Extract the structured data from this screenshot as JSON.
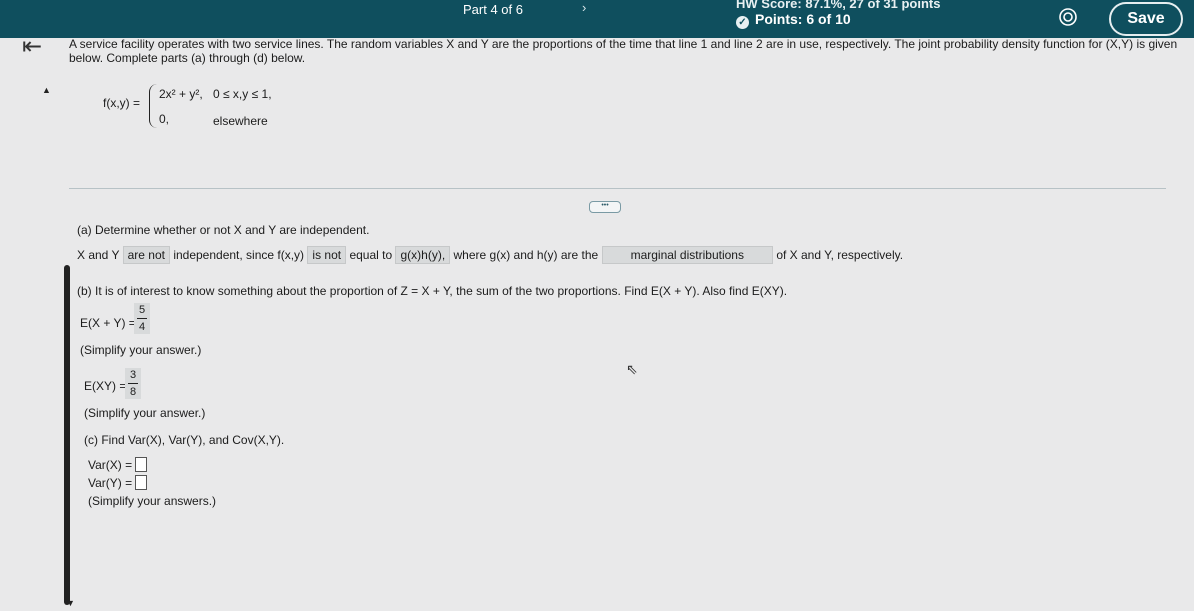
{
  "header": {
    "part": "Part 4 of 6",
    "next_chevron": "›",
    "hw_score": "HW Score: 87.1%, 27 of 31 points",
    "points": "Points: 6 of 10",
    "save_label": "Save"
  },
  "nav": {
    "back_icon": "⇤"
  },
  "problem": {
    "statement": "A service facility operates with two service lines. The random variables X and Y are the proportions of the time that line 1 and line 2 are in use, respectively. The joint probability density function for (X,Y) is given below. Complete parts (a) through (d) below.",
    "pdf_lhs": "f(x,y) =",
    "case1_expr": "2x² + y²,",
    "case1_domain": "0 ≤ x,y ≤ 1,",
    "case2_expr": "0,",
    "case2_domain": "elsewhere"
  },
  "more_button": "•••",
  "part_a": {
    "question": "(a) Determine whether or not X and Y are independent.",
    "pre": "X and Y",
    "answer1": "are not",
    "mid1": "independent, since f(x,y)",
    "answer2": "is not",
    "mid2": "equal to",
    "answer3": "g(x)h(y),",
    "mid3": "where g(x) and h(y) are the",
    "answer4": "marginal distributions",
    "post": "of X and Y, respectively."
  },
  "part_b": {
    "question": "(b) It is of interest to know something about the proportion of Z = X + Y, the sum of the two proportions. Find E(X + Y). Also find E(XY).",
    "exy_sum_label": "E(X + Y) =",
    "exy_sum_num": "5",
    "exy_sum_den": "4",
    "hint1": "(Simplify your answer.)",
    "exy_label": "E(XY) =",
    "exy_num": "3",
    "exy_den": "8",
    "hint2": "(Simplify your answer.)"
  },
  "part_c": {
    "question": "(c) Find Var(X), Var(Y), and Cov(X,Y).",
    "varx_label": "Var(X) =",
    "vary_label": "Var(Y) =",
    "hint": "(Simplify your answers.)"
  }
}
